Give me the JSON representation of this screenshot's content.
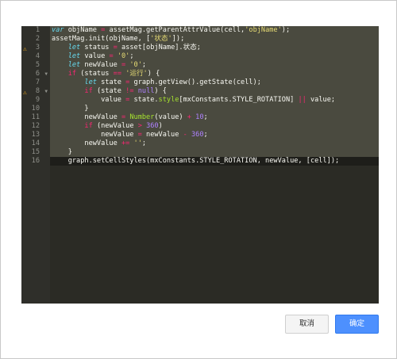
{
  "editor": {
    "line_numbers": [
      "1",
      "2",
      "3",
      "4",
      "5",
      "6",
      "7",
      "8",
      "9",
      "10",
      "11",
      "12",
      "13",
      "14",
      "15",
      "16"
    ],
    "warning_lines": [
      3,
      8
    ],
    "fold_lines": [
      6,
      8
    ],
    "code_lines": [
      "var objName = assetMag.getParentAttrValue(cell,'objName');",
      "assetMag.init(objName, ['状态']);",
      "    let status = asset[objName].状态;",
      "    let value = '0';",
      "    let newValue = '0';",
      "    if (status == '运行') {",
      "        let state = graph.getView().getState(cell);",
      "        if (state != null) {",
      "            value = state.style[mxConstants.STYLE_ROTATION] || value;",
      "        }",
      "        newValue = Number(value) + 10;",
      "        if (newValue > 360)",
      "            newValue = newValue - 360;",
      "        newValue += '';",
      "    }",
      "    graph.setCellStyles(mxConstants.STYLE_ROTATION, newValue, [cell]);"
    ],
    "active_line": 16,
    "warning_icon": "warning-icon",
    "fold_icon": "fold-arrow-icon"
  },
  "buttons": {
    "cancel_label": "取消",
    "ok_label": "确定"
  },
  "colors": {
    "editor_bg": "#2b2b25",
    "keyword": "#66d9ef",
    "string": "#e6db74",
    "number": "#ae81ff",
    "function": "#a6e22e",
    "operator": "#f92672",
    "warning": "#e8a317",
    "ok_button": "#4d90fe"
  }
}
